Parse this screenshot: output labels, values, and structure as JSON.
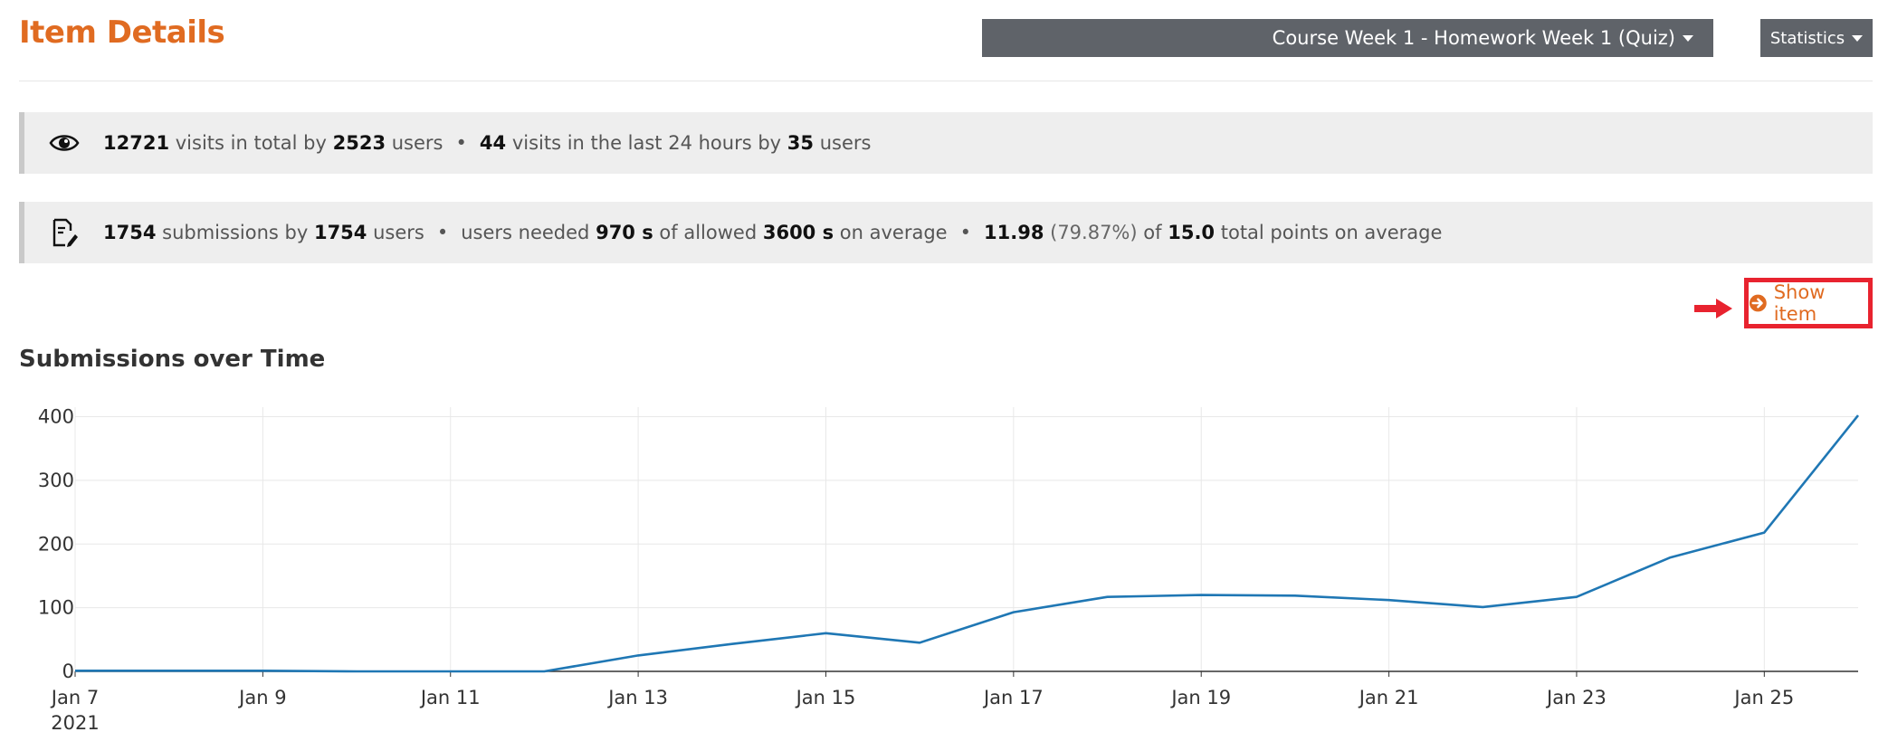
{
  "header": {
    "title": "Item Details",
    "course_selector": "Course Week 1 - Homework Week 1 (Quiz)",
    "stats_menu": "Statistics"
  },
  "visits": {
    "icon": "eye-icon",
    "total_visits": "12721",
    "text_visits_in_total_by": "visits in total by",
    "total_users": "2523",
    "text_users_1": "users",
    "recent_visits": "44",
    "text_visits_last_24h_by": "visits in the last 24 hours by",
    "recent_users": "35",
    "text_users_2": "users"
  },
  "submissions": {
    "icon": "edit-document-icon",
    "count": "1754",
    "text_submissions_by": "submissions by",
    "users": "1754",
    "text_users": "users",
    "text_users_needed": "users needed",
    "needed_time": "970 s",
    "text_of_allowed": "of allowed",
    "allowed_time": "3600 s",
    "text_on_average_1": "on average",
    "avg_points": "11.98",
    "avg_percent": "(79.87%)",
    "text_of": "of",
    "total_points": "15.0",
    "text_total_points_on_average": "total points on average"
  },
  "actions": {
    "show_item": "Show item",
    "highlight_color": "#e8232f"
  },
  "colors": {
    "accent": "#e06b21",
    "dropdown_bg": "#5f6369",
    "info_bar_bg": "#eeeeee",
    "line": "#1f77b4"
  },
  "chart": {
    "title": "Submissions over Time"
  },
  "chart_data": {
    "type": "line",
    "title": "Submissions over Time",
    "xlabel": "",
    "ylabel": "",
    "x": [
      "2021-01-07",
      "2021-01-08",
      "2021-01-09",
      "2021-01-10",
      "2021-01-11",
      "2021-01-12",
      "2021-01-13",
      "2021-01-14",
      "2021-01-15",
      "2021-01-16",
      "2021-01-17",
      "2021-01-18",
      "2021-01-19",
      "2021-01-20",
      "2021-01-21",
      "2021-01-22",
      "2021-01-23",
      "2021-01-24",
      "2021-01-25",
      "2021-01-26"
    ],
    "values": [
      1,
      1,
      1,
      0,
      0,
      0,
      25,
      43,
      60,
      45,
      93,
      117,
      120,
      119,
      112,
      101,
      117,
      179,
      218,
      402
    ],
    "x_tick_labels": [
      "Jan 7",
      "Jan 9",
      "Jan 11",
      "Jan 13",
      "Jan 15",
      "Jan 17",
      "Jan 19",
      "Jan 21",
      "Jan 23",
      "Jan 25"
    ],
    "x_tick_year": "2021",
    "y_ticks": [
      0,
      100,
      200,
      300,
      400
    ],
    "ylim": [
      0,
      415
    ],
    "grid": true,
    "legend": "none"
  }
}
